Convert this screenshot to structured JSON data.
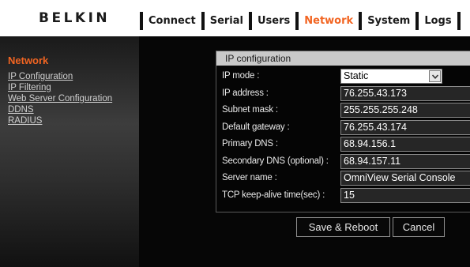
{
  "brand": {
    "logo": "BELKIN"
  },
  "nav": {
    "items": [
      {
        "label": "Connect",
        "active": false
      },
      {
        "label": "Serial",
        "active": false
      },
      {
        "label": "Users",
        "active": false
      },
      {
        "label": "Network",
        "active": true
      },
      {
        "label": "System",
        "active": false
      },
      {
        "label": "Logs",
        "active": false
      }
    ]
  },
  "sidebar": {
    "title": "Network",
    "links": [
      "IP Configuration",
      "IP Filtering",
      "Web Server Configuration",
      "DDNS",
      "RADIUS"
    ]
  },
  "panel": {
    "title": "IP configuration",
    "fields": [
      {
        "label": "IP mode :",
        "value": "Static",
        "type": "select"
      },
      {
        "label": "IP address :",
        "value": "76.255.43.173",
        "type": "text"
      },
      {
        "label": "Subnet mask :",
        "value": "255.255.255.248",
        "type": "text"
      },
      {
        "label": "Default gateway :",
        "value": "76.255.43.174",
        "type": "text"
      },
      {
        "label": "Primary DNS :",
        "value": "68.94.156.1",
        "type": "text"
      },
      {
        "label": "Secondary DNS (optional) :",
        "value": "68.94.157.11",
        "type": "text"
      },
      {
        "label": "Server name :",
        "value": "OmniView Serial Console",
        "type": "text"
      },
      {
        "label": "TCP keep-alive time(sec) :",
        "value": "15",
        "type": "text"
      }
    ]
  },
  "buttons": {
    "save": "Save & Reboot",
    "cancel": "Cancel"
  },
  "colors": {
    "accent": "#f26522",
    "panel_header": "#c9c9c9",
    "background": "#000000"
  },
  "icons": {
    "select_arrow": "chevron-down-icon"
  }
}
